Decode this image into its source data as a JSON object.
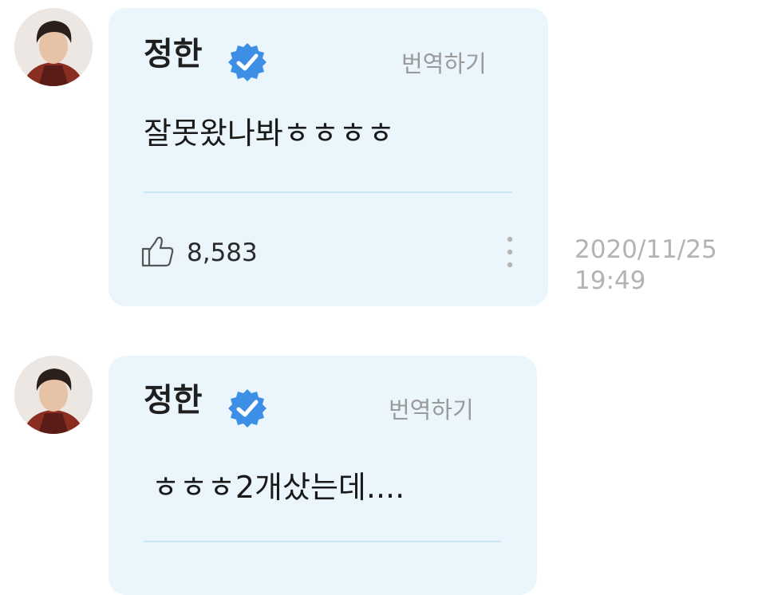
{
  "icons": {
    "avatar": "profile-photo",
    "verified": "verified-badge-icon",
    "like": "thumbs-up-icon",
    "more": "more-vertical-icon"
  },
  "colors": {
    "bubble": "#eaf6fc",
    "verified": "#3d8fe6",
    "divider": "#c9e7f0",
    "timestamp": "#b3b3b3"
  },
  "messages": [
    {
      "author": "정한",
      "translate_label": "번역하기",
      "text": "잘못왔나봐ㅎㅎㅎㅎ",
      "likes": "8,583",
      "date": "2020/11/25",
      "time": "19:49"
    },
    {
      "author": "정한",
      "translate_label": "번역하기",
      "text": "ㅎㅎㅎ2개샀는데...."
    }
  ]
}
